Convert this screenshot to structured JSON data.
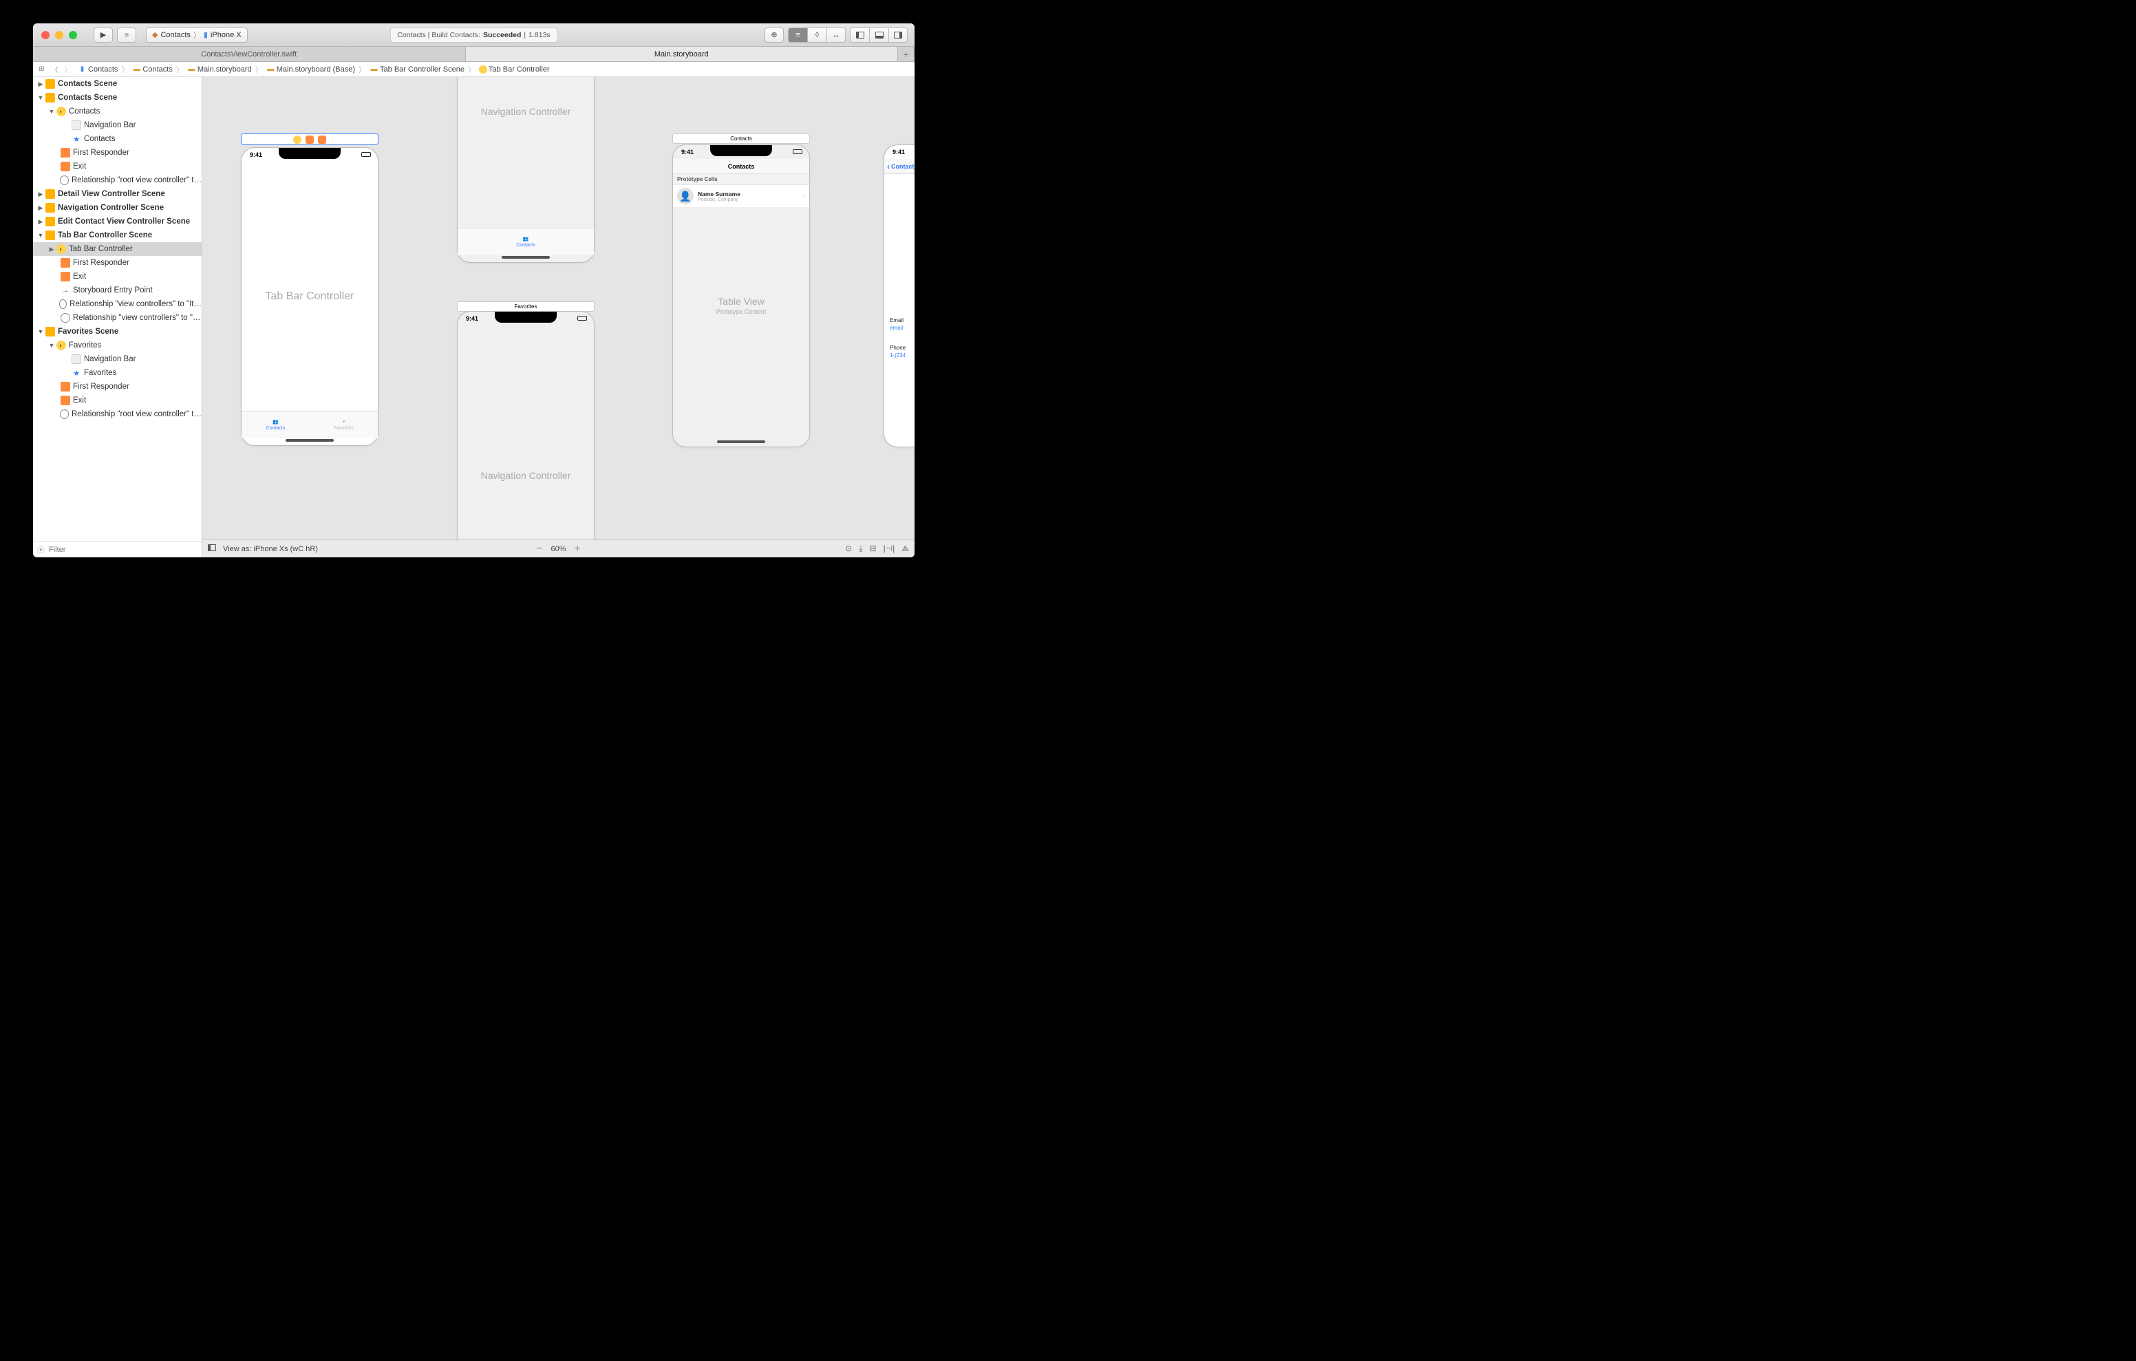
{
  "titlebar": {
    "scheme_app": "Contacts",
    "scheme_device": "iPhone X",
    "activity_prefix": "Contacts | Build Contacts:",
    "activity_status": "Succeeded",
    "activity_time": "1.813s"
  },
  "tabs": {
    "left": "ContactsViewController.swift",
    "right": "Main.storyboard"
  },
  "jumpbar": {
    "items": [
      "Contacts",
      "Contacts",
      "Main.storyboard",
      "Main.storyboard (Base)",
      "Tab Bar Controller Scene",
      "Tab Bar Controller"
    ]
  },
  "outline": {
    "contacts_scene_1": "Contacts Scene",
    "contacts_scene_2": "Contacts Scene",
    "contacts_vc": "Contacts",
    "navigation_bar": "Navigation Bar",
    "contacts_item": "Contacts",
    "first_responder": "First Responder",
    "exit": "Exit",
    "rel_root": "Relationship \"root view controller\" t…",
    "detail_scene": "Detail View Controller Scene",
    "nav_scene": "Navigation Controller Scene",
    "edit_scene": "Edit Contact View Controller Scene",
    "tabbar_scene": "Tab Bar Controller Scene",
    "tabbar_vc": "Tab Bar Controller",
    "entry_point": "Storyboard Entry Point",
    "rel_vc1": "Relationship \"view controllers\" to \"It…",
    "rel_vc2": "Relationship \"view controllers\" to \"…",
    "fav_scene": "Favorites Scene",
    "fav_vc": "Favorites",
    "fav_item": "Favorites",
    "filter_placeholder": "Filter"
  },
  "canvas": {
    "time": "9:41",
    "tabbar_title": "Tab Bar Controller",
    "nav_title": "Navigation Controller",
    "tab_contacts": "Contacts",
    "tab_favorites": "Favorites",
    "scene_contacts": "Contacts",
    "scene_favorites": "Favorites",
    "table_view": "Table View",
    "proto_content": "Prototype Content",
    "proto_cells": "Prototype Cells",
    "cell_name": "Name Surname",
    "cell_sub": "Position, Company",
    "detail_back": "Contacts",
    "detail_email_lbl": "Email",
    "detail_email_val": "email",
    "detail_phone_lbl": "Phone",
    "detail_phone_val": "1-(234"
  },
  "bottombar": {
    "view_as": "View as: iPhone Xs (wC hR)",
    "zoom": "60%"
  }
}
